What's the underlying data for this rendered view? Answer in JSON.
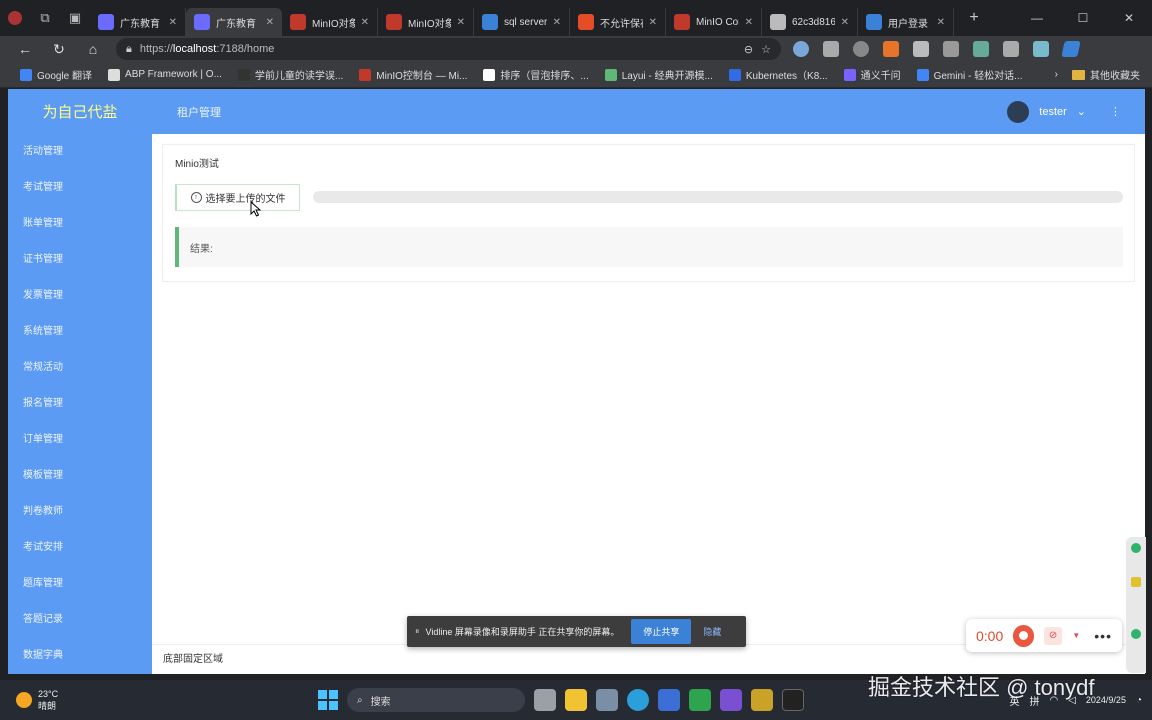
{
  "browser": {
    "tabs": [
      {
        "label": "广东教育",
        "color": "#6b6bff"
      },
      {
        "label": "广东教育",
        "color": "#6b6bff",
        "active": true
      },
      {
        "label": "MinIO对象",
        "color": "#c0392b"
      },
      {
        "label": "MinIO对象",
        "color": "#c0392b"
      },
      {
        "label": "sql server",
        "color": "#3b82d6"
      },
      {
        "label": "不允许保存",
        "color": "#e44d26"
      },
      {
        "label": "MinIO Con",
        "color": "#c0392b"
      },
      {
        "label": "62c3d816",
        "color": "#bbbbbb"
      },
      {
        "label": "用户登录",
        "color": "#3b82d6"
      }
    ],
    "url_prefix": "https://",
    "url_host": "localhost",
    "url_rest": ":7188/home",
    "bookmarks": [
      {
        "label": "Google 翻译",
        "color": "#4285f4"
      },
      {
        "label": "ABP Framework | O...",
        "color": "#dddddd"
      },
      {
        "label": "学前儿童的读学误...",
        "color": "#333333"
      },
      {
        "label": "MinIO控制台 — Mi...",
        "color": "#c0392b"
      },
      {
        "label": "排序（冒泡排序、...",
        "color": "#ffffff"
      },
      {
        "label": "Layui - 经典开源模...",
        "color": "#5fb878"
      },
      {
        "label": "Kubernetes（K8...",
        "color": "#326ce5"
      },
      {
        "label": "通义千问",
        "color": "#7b61ff"
      },
      {
        "label": "Gemini - 轻松对话...",
        "color": "#4285f4"
      }
    ],
    "other_bookmarks": "其他收藏夹"
  },
  "app": {
    "logo": "为自己代盐",
    "header_nav": "租户管理",
    "username": "tester",
    "menu": [
      "活动管理",
      "考试管理",
      "账单管理",
      "证书管理",
      "发票管理",
      "系统管理",
      "常规活动",
      "报名管理",
      "订单管理",
      "模板管理",
      "判卷教师",
      "考试安排",
      "题库管理",
      "答题记录",
      "数据字典"
    ],
    "card_title": "Minio测试",
    "upload_label": "选择要上传的文件",
    "upload_progress": 0,
    "result_label": "结果:",
    "footer": "底部固定区域"
  },
  "share_banner": {
    "message": "Vidline 屏幕录像和录屏助手 正在共享你的屏幕。",
    "stop_label": "停止共享",
    "hide_label": "隐藏"
  },
  "recorder": {
    "time": "0:00"
  },
  "taskbar": {
    "temperature": "23°C",
    "weather": "晴朗",
    "search_placeholder": "搜索",
    "ime_1": "英",
    "ime_2": "拼",
    "date": "2024/9/25"
  },
  "watermark": "掘金技术社区 @ tonydf",
  "colors": {
    "header_blue": "#5b9bf3",
    "accent_green": "#5fb878",
    "logo_yellow": "#fffa8a"
  }
}
